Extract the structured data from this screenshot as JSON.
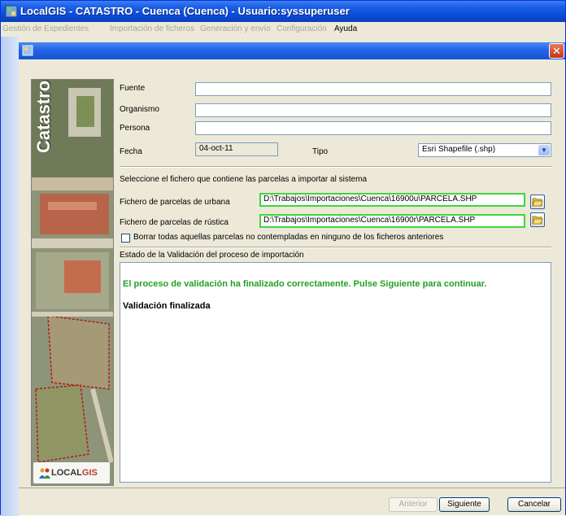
{
  "window": {
    "title": "LocalGIS - CATASTRO - Cuenca (Cuenca) - Usuario:syssuperuser"
  },
  "menu": {
    "items": [
      {
        "label": "Gestión de Expedientes",
        "enabled": false
      },
      {
        "label": "Importación de ficheros",
        "enabled": false
      },
      {
        "label": "Generación y envío",
        "enabled": false
      },
      {
        "label": "Configuración",
        "enabled": false
      },
      {
        "label": "Ayuda",
        "enabled": true
      }
    ]
  },
  "dialog": {
    "close_label": "✕",
    "side_panel": {
      "title": "Catastro",
      "logo_prefix": "LOCAL",
      "logo_suffix": "GIS"
    },
    "form": {
      "fuente_label": "Fuente",
      "fuente_value": "",
      "organismo_label": "Organismo",
      "organismo_value": "",
      "persona_label": "Persona",
      "persona_value": "",
      "fecha_label": "Fecha",
      "fecha_value": "04-oct-11",
      "tipo_label": "Tipo",
      "tipo_value": "Esri Shapefile (.shp)"
    },
    "files": {
      "instruction": "Seleccione el fichero que contiene las parcelas a importar al sistema",
      "urbana_label": "Fichero de parcelas de urbana",
      "urbana_value": "D:\\Trabajos\\Importaciones\\Cuenca\\16900u\\PARCELA.SHP",
      "rustica_label": "Fichero de parcelas de rústica",
      "rustica_value": "D:\\Trabajos\\Importaciones\\Cuenca\\16900r\\PARCELA.SHP",
      "delete_checkbox_label": "Borrar todas aquellas parcelas no contempladas en ninguno de los ficheros anteriores",
      "delete_checked": false
    },
    "validation": {
      "section_label": "Estado de la Validación del proceso de importación",
      "success_message": "El proceso de validación ha finalizado correctamente. Pulse Siguiente para continuar.",
      "final_message": "Validación finalizada"
    },
    "buttons": {
      "anterior": "Anterior",
      "siguiente": "Siguiente",
      "cancelar": "Cancelar"
    }
  },
  "colors": {
    "titlebar": "#0a4bd8",
    "success_text": "#22a022",
    "valid_border": "#3ed63e"
  }
}
